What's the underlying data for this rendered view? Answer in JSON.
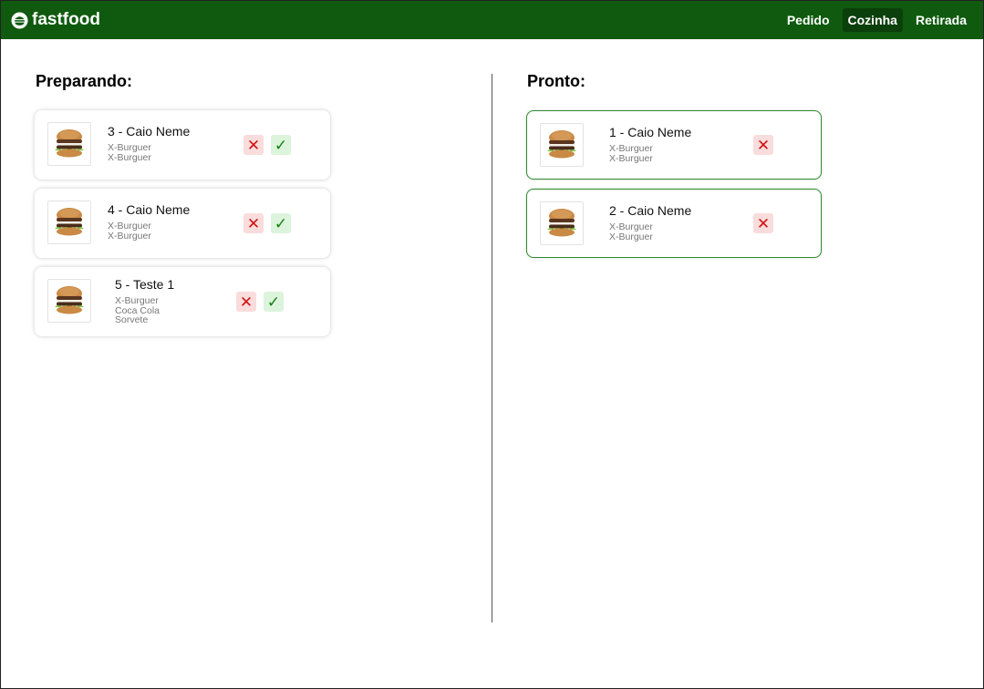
{
  "brand": {
    "name": "fastfood"
  },
  "nav": [
    {
      "label": "Pedido",
      "active": false
    },
    {
      "label": "Cozinha",
      "active": true
    },
    {
      "label": "Retirada",
      "active": false
    }
  ],
  "sections": {
    "preparing": {
      "title": "Preparando:",
      "orders": [
        {
          "title": "3 - Caio Neme",
          "items": [
            "X-Burguer",
            "X-Burguer"
          ]
        },
        {
          "title": "4 - Caio Neme",
          "items": [
            "X-Burguer",
            "X-Burguer"
          ]
        },
        {
          "title": "5 - Teste 1",
          "items": [
            "X-Burguer",
            "Coca Cola",
            "Sorvete"
          ]
        }
      ]
    },
    "ready": {
      "title": "Pronto:",
      "orders": [
        {
          "title": "1 - Caio Neme",
          "items": [
            "X-Burguer",
            "X-Burguer"
          ]
        },
        {
          "title": "2 - Caio Neme",
          "items": [
            "X-Burguer",
            "X-Burguer"
          ]
        }
      ]
    }
  },
  "icons": {
    "cancel": "✕",
    "confirm": "✓"
  },
  "colors": {
    "navbar": "#0f5a0f",
    "nav_active": "#0b3f0b",
    "cancel": "#d11212",
    "confirm": "#148014",
    "ready_border": "#2e8b2e"
  }
}
